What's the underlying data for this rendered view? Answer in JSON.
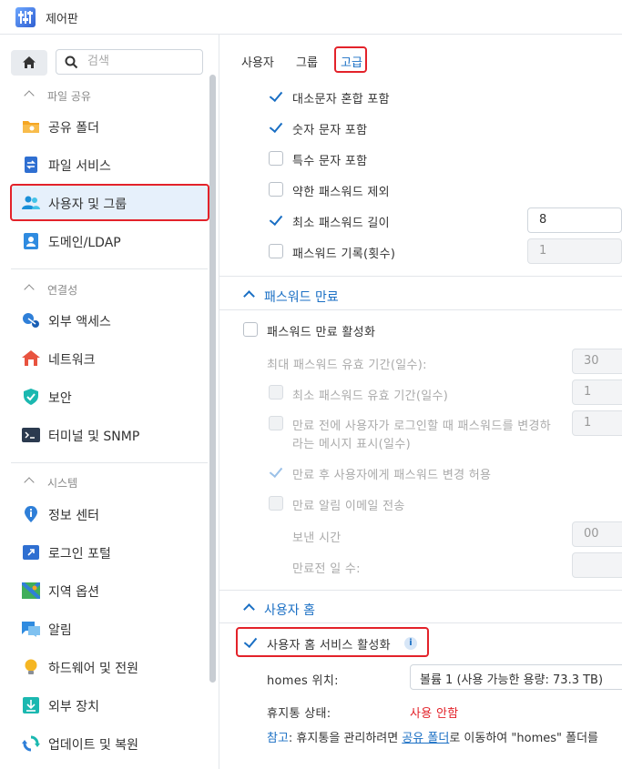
{
  "window": {
    "title": "제어판"
  },
  "sidebar": {
    "search_placeholder": "검색",
    "sections": [
      {
        "label": "파일 공유",
        "items": [
          {
            "label": "공유 폴더",
            "icon": "folder-icon"
          },
          {
            "label": "파일 서비스",
            "icon": "file-services-icon"
          },
          {
            "label": "사용자 및 그룹",
            "icon": "users-icon",
            "active": true
          },
          {
            "label": "도메인/LDAP",
            "icon": "domain-icon"
          }
        ]
      },
      {
        "label": "연결성",
        "items": [
          {
            "label": "외부 액세스",
            "icon": "external-access-icon"
          },
          {
            "label": "네트워크",
            "icon": "network-icon"
          },
          {
            "label": "보안",
            "icon": "shield-icon"
          },
          {
            "label": "터미널 및 SNMP",
            "icon": "terminal-icon"
          }
        ]
      },
      {
        "label": "시스템",
        "items": [
          {
            "label": "정보 센터",
            "icon": "info-center-icon"
          },
          {
            "label": "로그인 포털",
            "icon": "login-portal-icon"
          },
          {
            "label": "지역 옵션",
            "icon": "regional-options-icon"
          },
          {
            "label": "알림",
            "icon": "notification-icon"
          },
          {
            "label": "하드웨어 및 전원",
            "icon": "bulb-icon"
          },
          {
            "label": "외부 장치",
            "icon": "external-devices-icon"
          },
          {
            "label": "업데이트 및 복원",
            "icon": "update-restore-icon"
          }
        ]
      }
    ]
  },
  "tabs": [
    {
      "label": "사용자"
    },
    {
      "label": "그룹"
    },
    {
      "label": "고급",
      "active": true
    }
  ],
  "password_rules": [
    {
      "label": "대소문자 혼합 포함",
      "checked": true
    },
    {
      "label": "숫자 문자 포함",
      "checked": true
    },
    {
      "label": "특수 문자 포함",
      "checked": false
    },
    {
      "label": "약한 패스워드 제외",
      "checked": false
    },
    {
      "label": "최소 패스워드 길이",
      "checked": true,
      "value": "8"
    },
    {
      "label": "패스워드 기록(횟수)",
      "checked": false,
      "value": "1"
    }
  ],
  "password_expiry": {
    "heading": "패스워드 만료",
    "enable_label": "패스워드 만료 활성화",
    "enabled": false,
    "max_validity_label": "최대 패스워드 유효 기간(일수):",
    "max_validity_value": "30",
    "min_validity_label": "최소 패스워드 유효 기간(일수)",
    "min_validity_value": "1",
    "prompt_line1": "만료 전에 사용자가 로그인할 때 패스워드를 변경하",
    "prompt_line2": "라는 메시지 표시(일수)",
    "prompt_value": "1",
    "allow_change_label": "만료 후 사용자에게 패스워드 변경 허용",
    "allow_change_checked": true,
    "email_label": "만료 알림 이메일 전송",
    "send_time_label": "보낸 시간",
    "send_time_value": "00",
    "days_before_label": "만료전 일 수:"
  },
  "user_home": {
    "heading": "사용자 홈",
    "enable_label": "사용자 홈 서비스 활성화",
    "enabled": true,
    "location_label": "homes 위치:",
    "location_value": "볼륨 1 (사용 가능한 용량:  73.3 TB)",
    "recycle_label": "휴지통 상태:",
    "recycle_value": "사용 안함",
    "note_prefix": "참고",
    "note_text1": ": 휴지통을 관리하려면 ",
    "note_link": "공유 폴더",
    "note_text2": "로 이동하여 \"homes\" 폴더를"
  }
}
